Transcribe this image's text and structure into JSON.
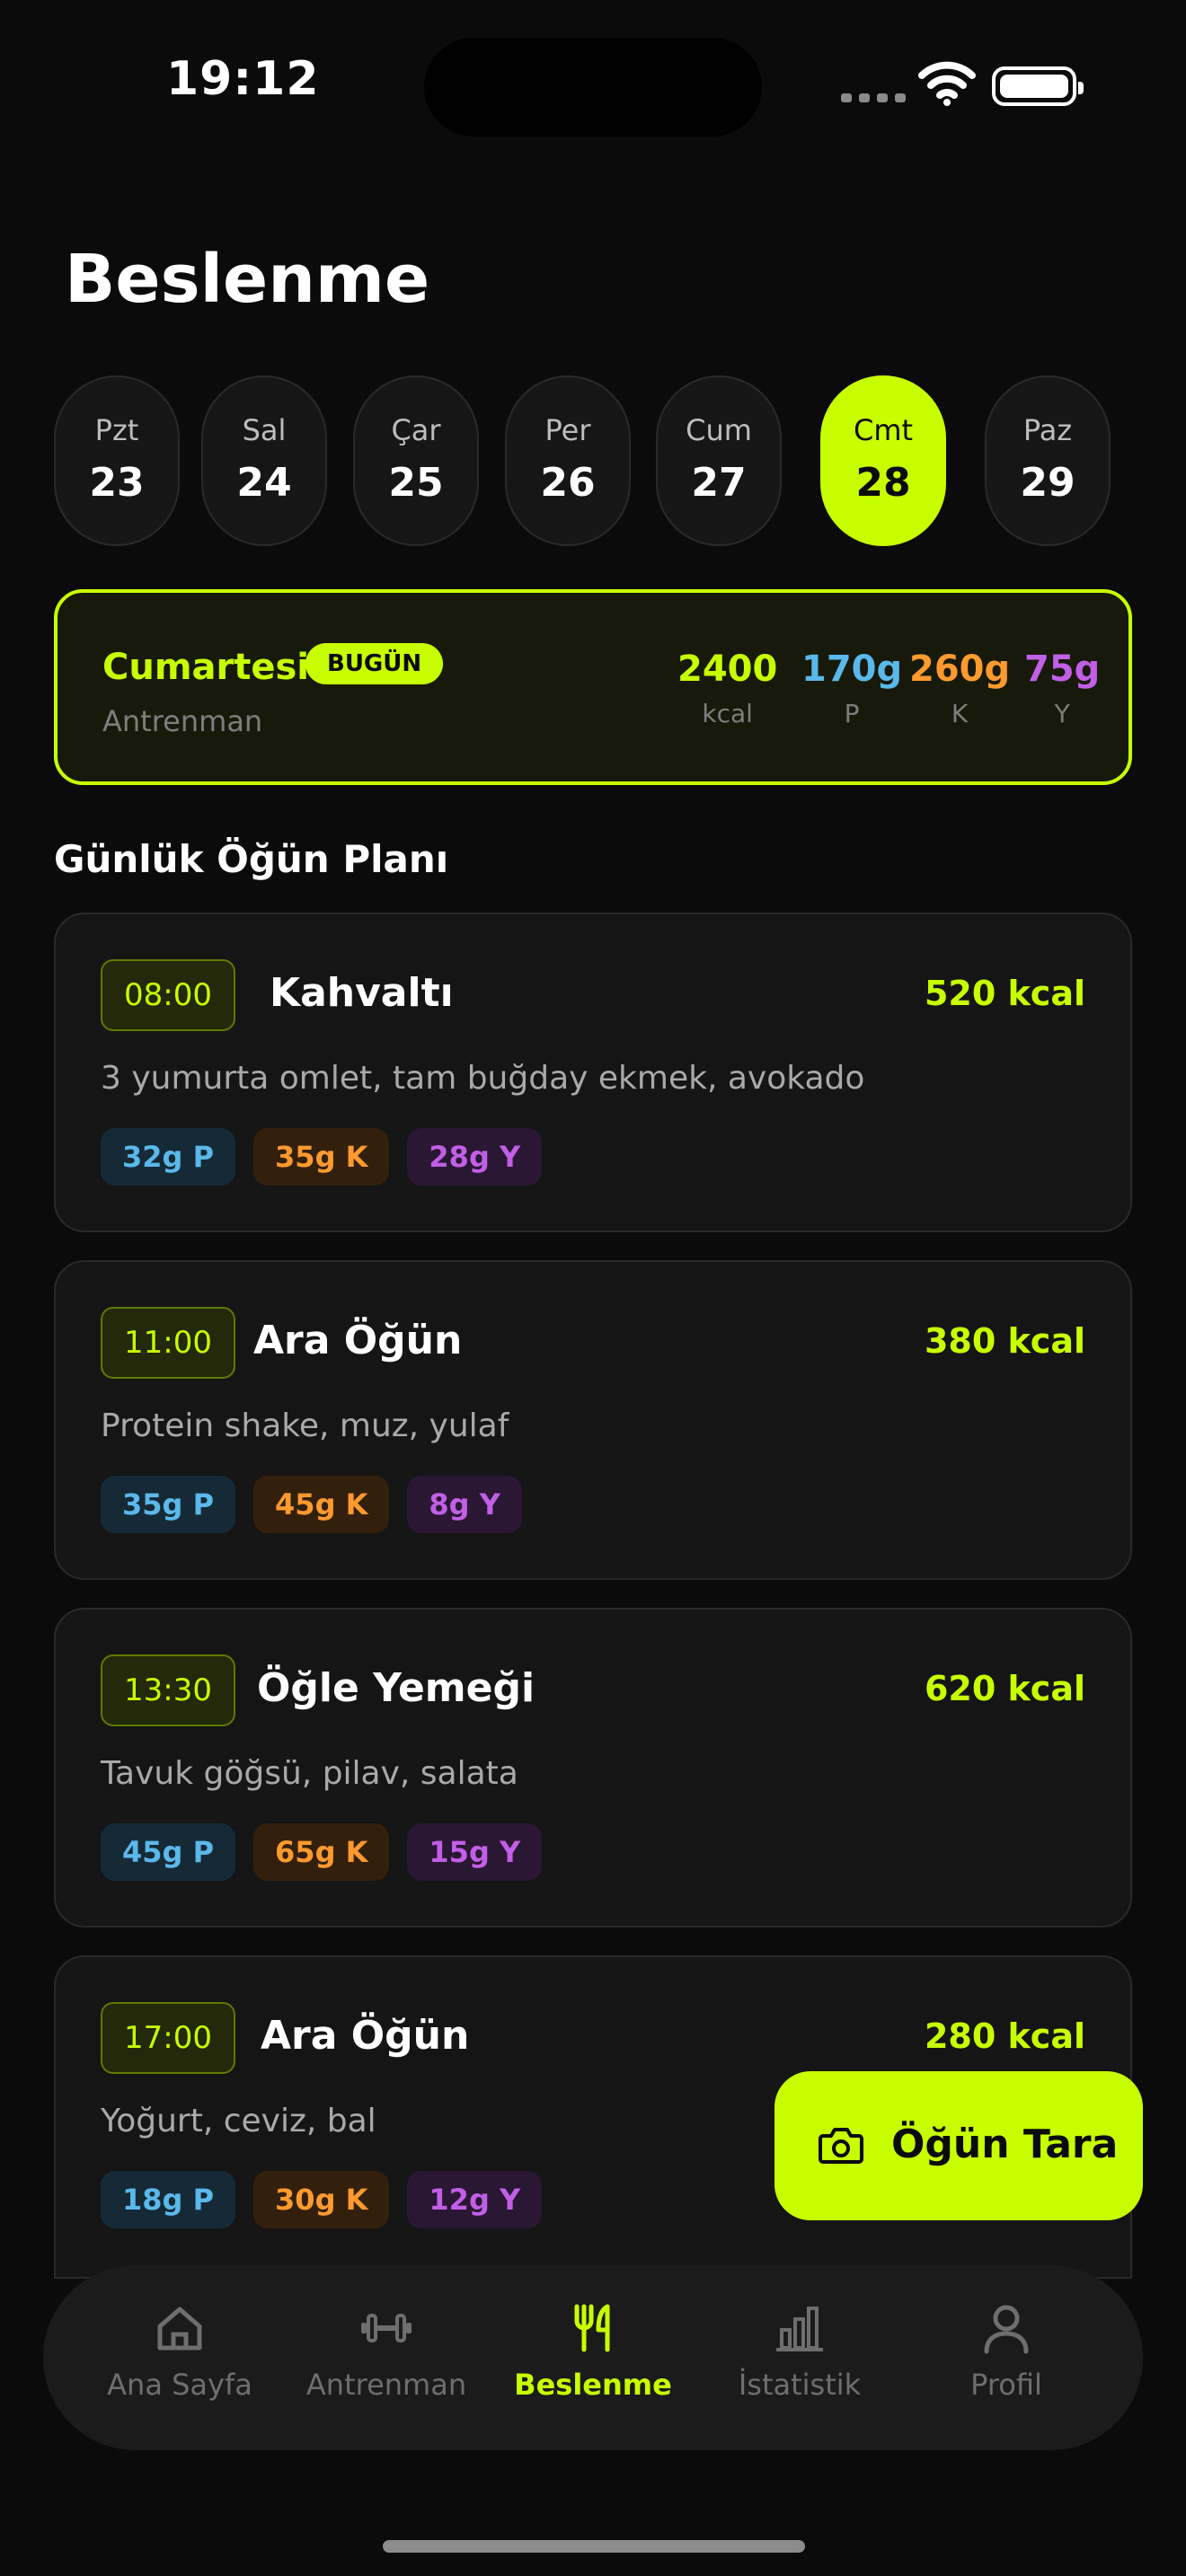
{
  "status": {
    "time": "19:12"
  },
  "page": {
    "title": "Beslenme"
  },
  "days": [
    {
      "name": "Pzt",
      "date": "23"
    },
    {
      "name": "Sal",
      "date": "24"
    },
    {
      "name": "Çar",
      "date": "25"
    },
    {
      "name": "Per",
      "date": "26"
    },
    {
      "name": "Cum",
      "date": "27"
    },
    {
      "name": "Cmt",
      "date": "28"
    },
    {
      "name": "Paz",
      "date": "29"
    }
  ],
  "summary": {
    "day": "Cumartesi",
    "badge": "BUGÜN",
    "subtitle": "Antrenman",
    "kcal": {
      "value": "2400",
      "label": "kcal"
    },
    "protein": {
      "value": "170g",
      "label": "P"
    },
    "carb": {
      "value": "260g",
      "label": "K"
    },
    "fat": {
      "value": "75g",
      "label": "Y"
    }
  },
  "section_title": "Günlük Öğün Planı",
  "meals": [
    {
      "time": "08:00",
      "name": "Kahvaltı",
      "kcal": "520 kcal",
      "desc": "3 yumurta omlet, tam buğday ekmek, avokado",
      "p": "32g P",
      "k": "35g K",
      "y": "28g Y"
    },
    {
      "time": "11:00",
      "name": "Ara Öğün",
      "kcal": "380 kcal",
      "desc": "Protein shake, muz, yulaf",
      "p": "35g P",
      "k": "45g K",
      "y": "8g Y"
    },
    {
      "time": "13:30",
      "name": "Öğle Yemeği",
      "kcal": "620 kcal",
      "desc": "Tavuk göğsü, pilav, salata",
      "p": "45g P",
      "k": "65g K",
      "y": "15g Y"
    },
    {
      "time": "17:00",
      "name": "Ara Öğün",
      "kcal": "280 kcal",
      "desc": "Yoğurt, ceviz, bal",
      "p": "18g P",
      "k": "30g K",
      "y": "12g Y"
    }
  ],
  "fab": {
    "label": "Öğün Tara",
    "icon": "camera-icon"
  },
  "tabs": [
    {
      "label": "Ana Sayfa",
      "icon": "home-icon"
    },
    {
      "label": "Antrenman",
      "icon": "dumbbell-icon"
    },
    {
      "label": "Beslenme",
      "icon": "fork-knife-icon"
    },
    {
      "label": "İstatistik",
      "icon": "bar-chart-icon"
    },
    {
      "label": "Profil",
      "icon": "user-icon"
    }
  ],
  "colors": {
    "accent": "#c8ff00",
    "protein": "#5ab8ea",
    "carb": "#ff9a2e",
    "fat": "#c15fe6",
    "background": "#0b0b0b"
  }
}
